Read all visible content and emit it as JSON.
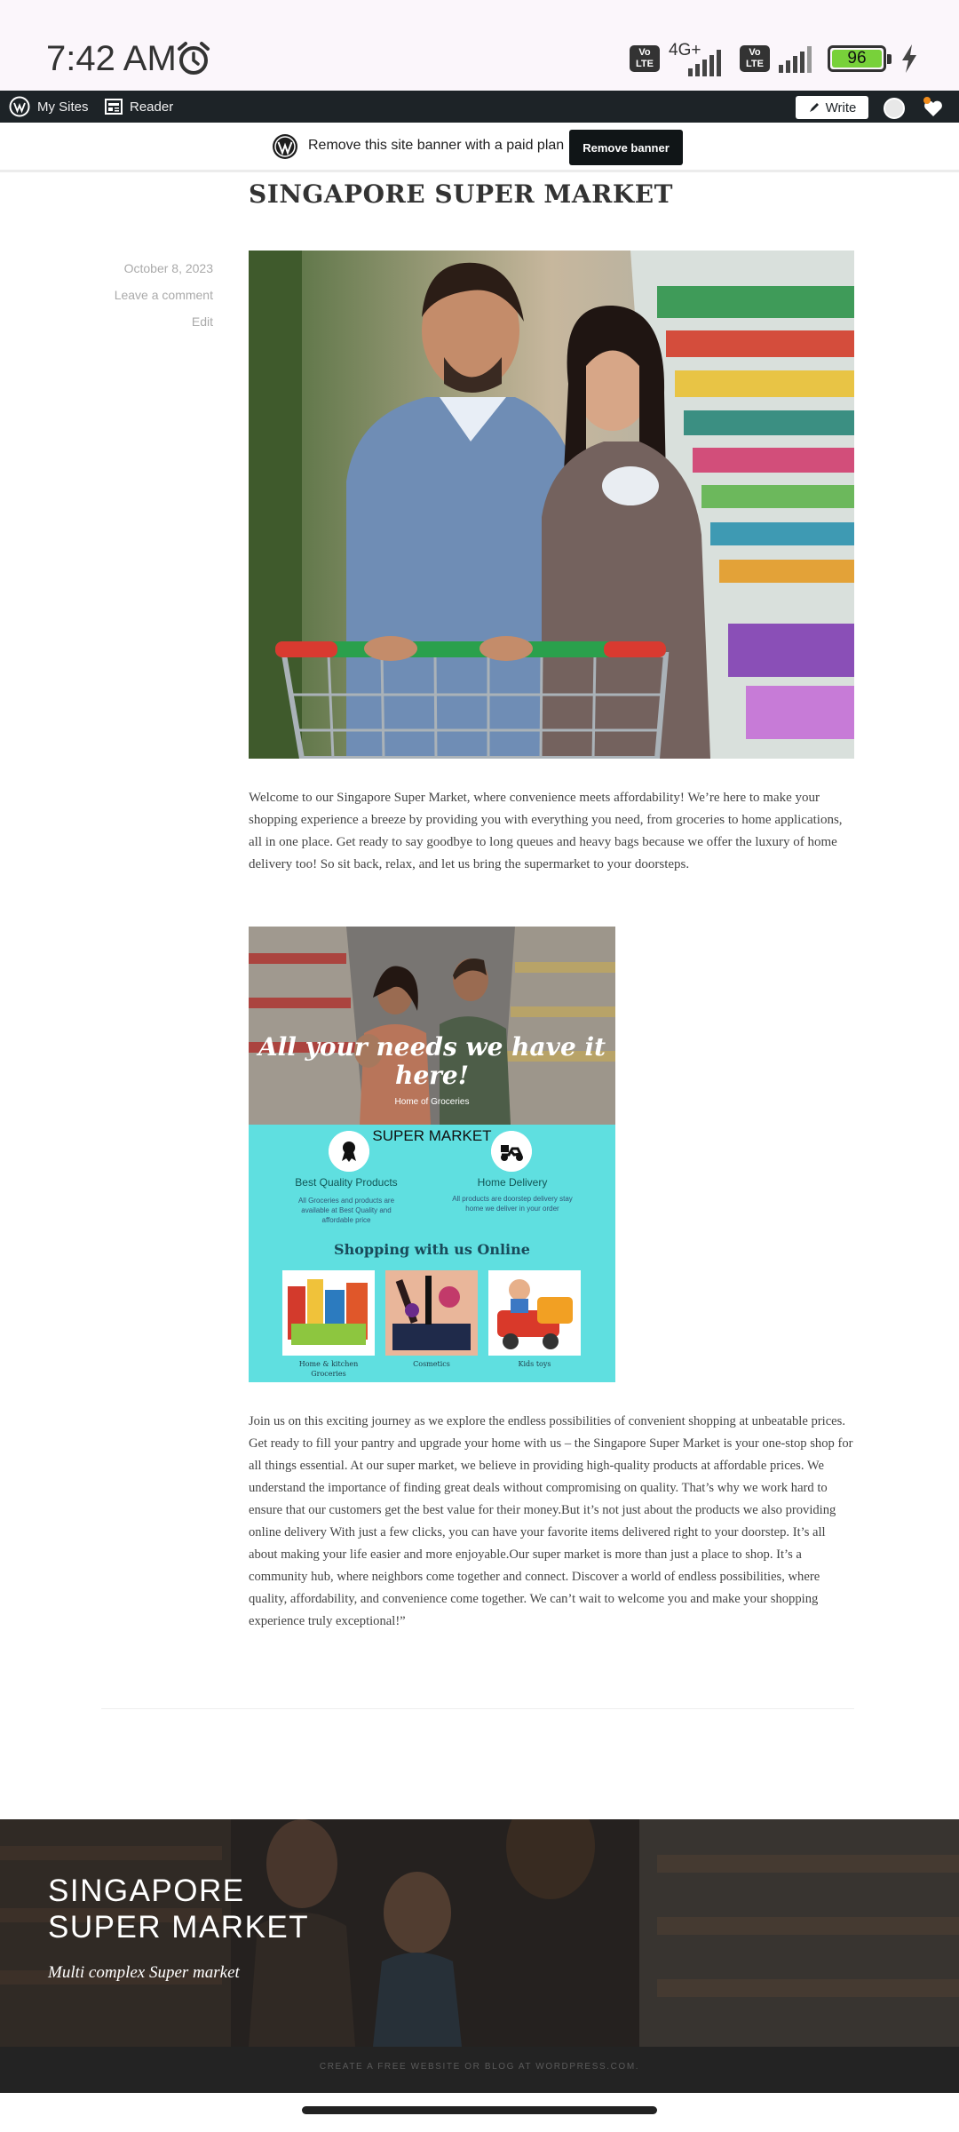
{
  "status_bar": {
    "time": "7:42 AM",
    "network": "4G+",
    "volte": "Vo LTE",
    "battery": "96"
  },
  "admin_bar": {
    "my_sites": "My Sites",
    "reader": "Reader",
    "write": "Write"
  },
  "banner": {
    "text": "Remove this site banner with a paid plan",
    "button": "Remove banner"
  },
  "post": {
    "title": "SINGAPORE SUPER MARKET",
    "date": "October 8, 2023",
    "comment_link": "Leave a comment",
    "edit_link": "Edit",
    "paragraph1": "Welcome to our Singapore Super Market, where convenience meets affordability! We’re here to make your shopping experience a breeze by providing you with everything you need, from groceries to home applications, all in one place. Get ready to say goodbye to long queues and heavy bags because we offer the luxury of home delivery too! So sit back, relax, and let us bring the supermarket to your doorsteps.",
    "paragraph2": "Join us on this exciting journey as we explore the endless possibilities of convenient shopping at unbeatable prices. Get ready to fill your pantry and upgrade your home with us – the Singapore Super Market is your one-stop shop for all things essential. At our super market, we believe in providing high-quality products at affordable prices. We understand the importance of finding great deals without compromising on quality. That’s why we work hard to ensure that our customers get the best value for their money.But it’s not just about the products we also providing online delivery With just a few clicks, you can have your favorite items delivered right to your doorstep. It’s all about making your life easier and more enjoyable.Our super market is more than just a place to shop. It’s a community hub, where neighbors come together and connect. Discover a world of endless possibilities, where quality, affordability, and convenience come together. We can’t wait to welcome you and make your shopping experience truly exceptional!”"
  },
  "flyer": {
    "headline": "All your needs we have it here!",
    "tagline": "Home of Groceries",
    "brand": "SUPER MARKET",
    "feature1_title": "Best Quality Products",
    "feature1_desc": "All Groceries and products are available at Best Quality and affordable price",
    "feature2_title": "Home Delivery",
    "feature2_desc": "All products are doorstep delivery stay home we deliver in your order",
    "shop_title": "Shopping with us Online",
    "tiles": [
      {
        "caption": "Home & kitchen Groceries"
      },
      {
        "caption": "Cosmetics"
      },
      {
        "caption": "Kids toys"
      }
    ]
  },
  "footer": {
    "site_title_line1": "SINGAPORE",
    "site_title_line2": "SUPER MARKET",
    "site_description": "Multi complex Super market",
    "credit": "CREATE A FREE WEBSITE OR BLOG AT WORDPRESS.COM."
  }
}
